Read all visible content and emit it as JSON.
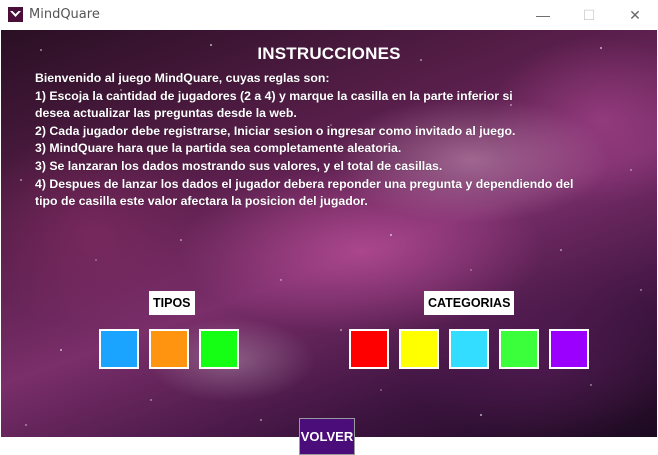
{
  "window": {
    "title": "MindQuare",
    "minimize_glyph": "—",
    "maximize_glyph": "☐",
    "close_glyph": "✕"
  },
  "instructions": {
    "heading": "INSTRUCCIONES",
    "lines": [
      "Bienvenido al juego MindQuare, cuyas reglas son:",
      "1) Escoja la cantidad de jugadores (2 a 4) y marque la casilla en la parte inferior si",
      "desea actualizar las preguntas desde la web.",
      "2) Cada jugador debe registrarse, Iniciar sesion o ingresar como invitado al juego.",
      "3) MindQuare hara que la partida sea completamente aleatoria.",
      "3) Se lanzaran los dados mostrando sus valores, y el total de casillas.",
      "4) Despues de lanzar los dados el jugador debera reponder una pregunta y dependiendo del",
      "tipo de casilla este valor afectara la posicion del jugador."
    ]
  },
  "tipos": {
    "label": "TIPOS",
    "colors": [
      "#1aa3ff",
      "#ff9411",
      "#14ff14"
    ]
  },
  "categorias": {
    "label": "CATEGORIAS",
    "colors": [
      "#ff0000",
      "#ffff00",
      "#33ddff",
      "#3cff3c",
      "#9b00ff"
    ]
  },
  "footer": {
    "volver_label": "VOLVER"
  },
  "app_icon_name": "mindquare-app-icon"
}
